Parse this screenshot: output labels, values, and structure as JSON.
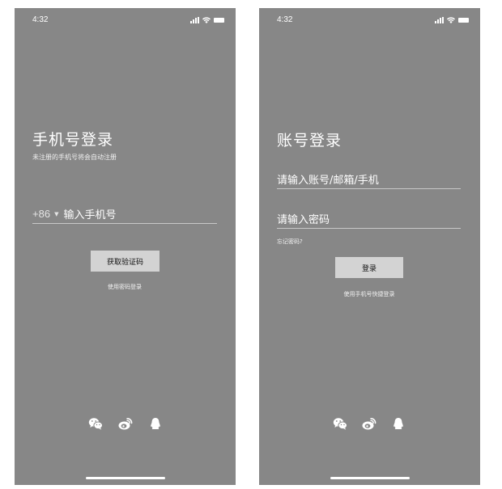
{
  "screens": [
    {
      "status_time": "4:32",
      "title": "手机号登录",
      "subtitle": "未注册的手机号将会自动注册",
      "country_code": "+86",
      "phone_placeholder": "输入手机号",
      "button_label": "获取验证码",
      "switch_link": "使用密码登录",
      "social_icons": [
        "wechat-icon",
        "weibo-icon",
        "qq-icon"
      ]
    },
    {
      "status_time": "4:32",
      "title": "账号登录",
      "account_placeholder": "请输入账号/邮箱/手机",
      "password_placeholder": "请输入密码",
      "forgot_link": "忘记密码?",
      "button_label": "登录",
      "switch_link": "使用手机号快捷登录",
      "social_icons": [
        "wechat-icon",
        "weibo-icon",
        "qq-icon"
      ]
    }
  ]
}
